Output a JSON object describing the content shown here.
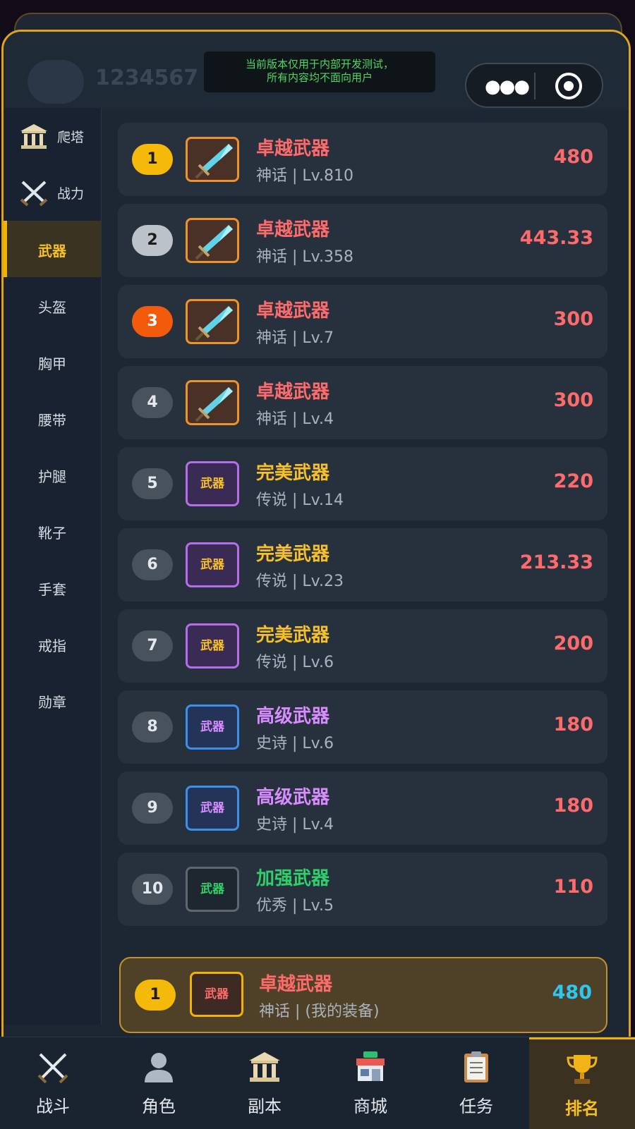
{
  "notice": {
    "line1": "当前版本仅用于内部开发测试，",
    "line2": "所有内容均不面向用户"
  },
  "background": {
    "player_id": "1234567"
  },
  "capsule": {
    "more_icon": "more-dots-icon",
    "close_icon": "target-icon"
  },
  "sidebar": {
    "items": [
      {
        "label": "爬塔",
        "icon": "temple-icon"
      },
      {
        "label": "战力",
        "icon": "crossed-swords-icon"
      },
      {
        "label": "武器"
      },
      {
        "label": "头盔"
      },
      {
        "label": "胸甲"
      },
      {
        "label": "腰带"
      },
      {
        "label": "护腿"
      },
      {
        "label": "靴子"
      },
      {
        "label": "手套"
      },
      {
        "label": "戒指"
      },
      {
        "label": "勋章"
      }
    ],
    "active_index": 2
  },
  "ranking": {
    "rows": [
      {
        "rank": "1",
        "name": "卓越武器",
        "sub": "神话 | Lv.810",
        "score": "480",
        "tier": "myth",
        "icon": "sword-icon"
      },
      {
        "rank": "2",
        "name": "卓越武器",
        "sub": "神话 | Lv.358",
        "score": "443.33",
        "tier": "myth",
        "icon": "sword-icon"
      },
      {
        "rank": "3",
        "name": "卓越武器",
        "sub": "神话 | Lv.7",
        "score": "300",
        "tier": "myth",
        "icon": "sword-icon"
      },
      {
        "rank": "4",
        "name": "卓越武器",
        "sub": "神话 | Lv.4",
        "score": "300",
        "tier": "myth",
        "icon": "sword-icon"
      },
      {
        "rank": "5",
        "name": "完美武器",
        "sub": "传说 | Lv.14",
        "score": "220",
        "tier": "legend",
        "icon_text": "武器"
      },
      {
        "rank": "6",
        "name": "完美武器",
        "sub": "传说 | Lv.23",
        "score": "213.33",
        "tier": "legend",
        "icon_text": "武器"
      },
      {
        "rank": "7",
        "name": "完美武器",
        "sub": "传说 | Lv.6",
        "score": "200",
        "tier": "legend",
        "icon_text": "武器"
      },
      {
        "rank": "8",
        "name": "高级武器",
        "sub": "史诗 | Lv.6",
        "score": "180",
        "tier": "epic",
        "icon_text": "武器"
      },
      {
        "rank": "9",
        "name": "高级武器",
        "sub": "史诗 | Lv.4",
        "score": "180",
        "tier": "epic",
        "icon_text": "武器"
      },
      {
        "rank": "10",
        "name": "加强武器",
        "sub": "优秀 | Lv.5",
        "score": "110",
        "tier": "rare",
        "icon_text": "武器"
      }
    ]
  },
  "my_entry": {
    "rank": "1",
    "icon_text": "武器",
    "name": "卓越武器",
    "sub": "神话 | (我的装备)",
    "score": "480"
  },
  "tabbar": {
    "tabs": [
      {
        "label": "战斗",
        "icon": "crossed-swords-icon"
      },
      {
        "label": "角色",
        "icon": "person-icon"
      },
      {
        "label": "副本",
        "icon": "temple-icon"
      },
      {
        "label": "商城",
        "icon": "store-icon"
      },
      {
        "label": "任务",
        "icon": "clipboard-icon"
      },
      {
        "label": "排名",
        "icon": "trophy-icon"
      }
    ],
    "active_index": 5
  },
  "colors": {
    "accent": "#f0b400",
    "myth": "#ff6b6b",
    "legend": "#f7c028",
    "epic": "#d88cff",
    "rare": "#2fd06a",
    "my_score": "#2ec7f0"
  }
}
